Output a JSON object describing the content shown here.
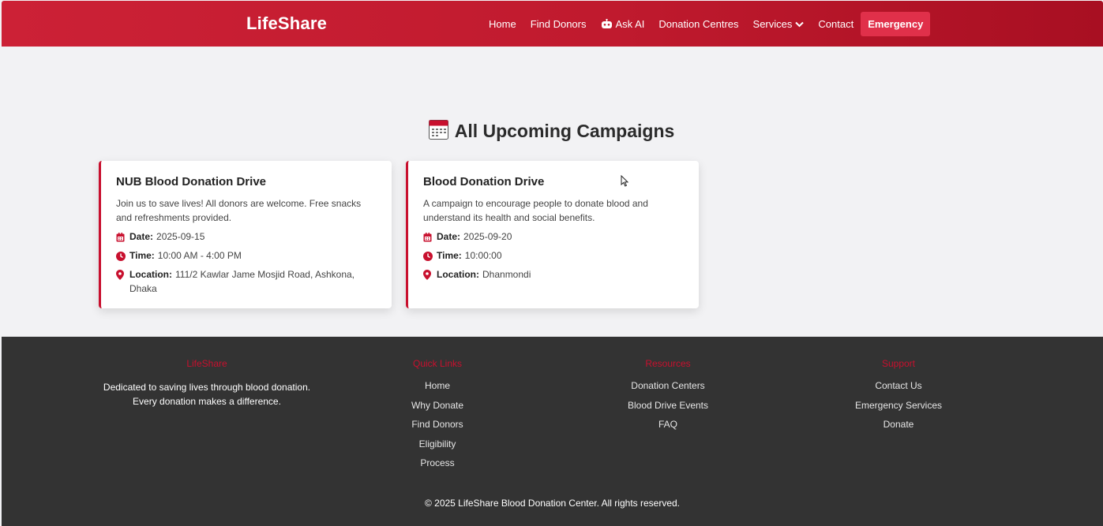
{
  "nav": {
    "brand": "LifeShare",
    "links": [
      "Home",
      "Find Donors",
      "Ask AI",
      "Donation Centres",
      "Services",
      "Contact"
    ],
    "emergency": "Emergency"
  },
  "main": {
    "title": "All Upcoming Campaigns",
    "campaigns": [
      {
        "title": "NUB Blood Donation Drive",
        "description": "Join us to save lives! All donors are welcome. Free snacks and refreshments provided.",
        "date_label": "Date:",
        "date": "2025-09-15",
        "time_label": "Time:",
        "time": "10:00 AM - 4:00 PM",
        "location_label": "Location:",
        "location": "111/2 Kawlar Jame Mosjid Road, Ashkona, Dhaka"
      },
      {
        "title": "Blood Donation Drive",
        "description": "A campaign to encourage people to donate blood and understand its health and social benefits.",
        "date_label": "Date:",
        "date": "2025-09-20",
        "time_label": "Time:",
        "time": "10:00:00",
        "location_label": "Location:",
        "location": "Dhanmondi"
      }
    ]
  },
  "footer": {
    "about": {
      "heading": "LifeShare",
      "text_line1": "Dedicated to saving lives through blood donation.",
      "text_line2": "Every donation makes a difference."
    },
    "quick_links": {
      "heading": "Quick Links",
      "items": [
        "Home",
        "Why Donate",
        "Find Donors",
        "Eligibility",
        "Process"
      ]
    },
    "resources": {
      "heading": "Resources",
      "items": [
        "Donation Centers",
        "Blood Drive Events",
        "FAQ"
      ]
    },
    "support": {
      "heading": "Support",
      "items": [
        "Contact Us",
        "Emergency Services",
        "Donate"
      ]
    },
    "copyright": "© 2025 LifeShare Blood Donation Center. All rights reserved."
  },
  "colors": {
    "brand_red": "#c8102e",
    "emergency_bg": "#e0304a",
    "footer_bg": "#333333"
  }
}
